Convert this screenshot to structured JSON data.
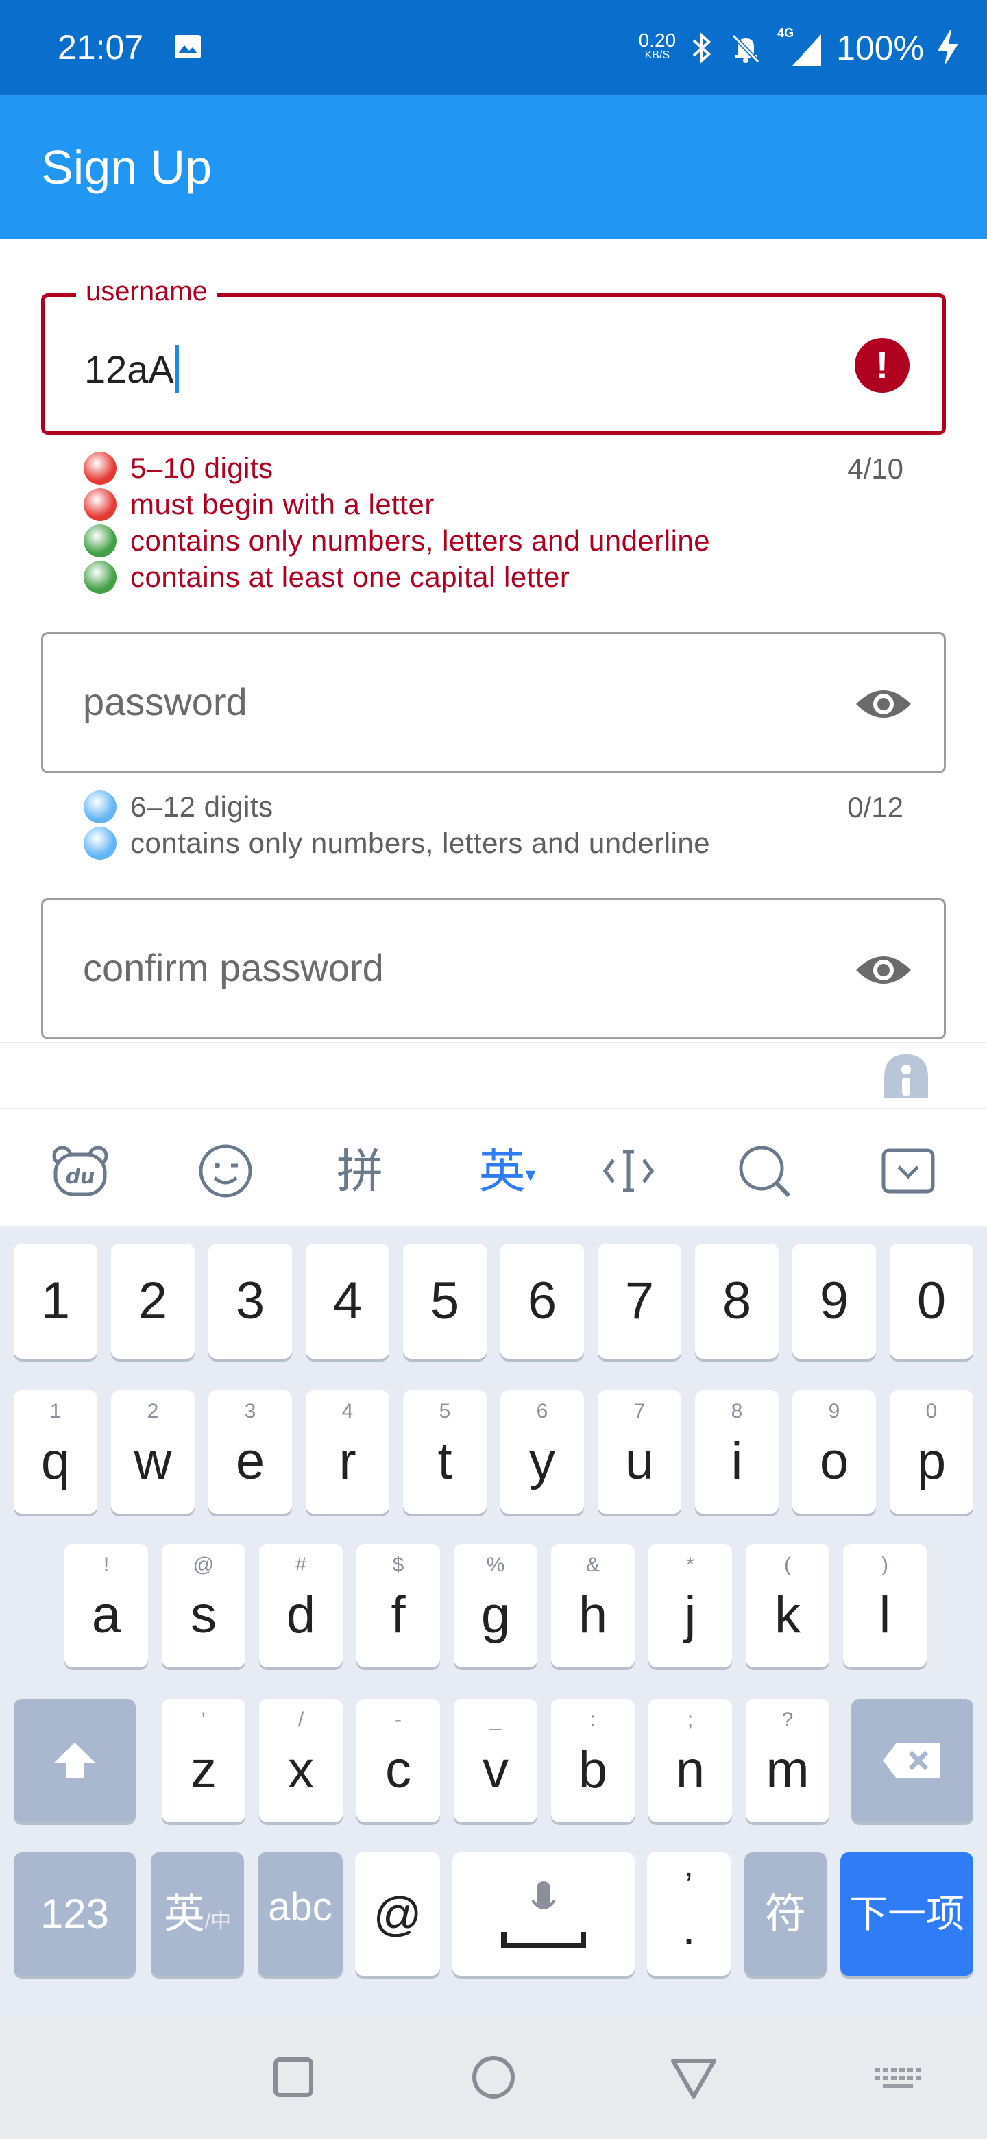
{
  "status": {
    "time": "21:07",
    "net_speed": "0.20",
    "net_unit": "KB/S",
    "signal": "4G",
    "battery": "100%"
  },
  "appbar": {
    "title": "Sign Up"
  },
  "username": {
    "label": "username",
    "value": "12aA",
    "counter": "4/10",
    "rules": [
      {
        "text": "5–10 digits",
        "status": "fail",
        "color": "#e53935"
      },
      {
        "text": "must begin with a letter",
        "status": "fail",
        "color": "#e53935"
      },
      {
        "text": "contains only numbers, letters and underline",
        "status": "pass",
        "color": "#43a047"
      },
      {
        "text": "contains at least one capital letter",
        "status": "pass",
        "color": "#43a047"
      }
    ]
  },
  "password": {
    "placeholder": "password",
    "counter": "0/12",
    "rules": [
      {
        "text": "6–12 digits",
        "status": "neutral",
        "color": "#64b5f6"
      },
      {
        "text": "contains only numbers, letters and underline",
        "status": "neutral",
        "color": "#64b5f6"
      }
    ]
  },
  "confirm": {
    "placeholder": "confirm password"
  },
  "keyboard": {
    "toolbar": {
      "pinyin": "拼",
      "english": "英"
    },
    "number_row": [
      "1",
      "2",
      "3",
      "4",
      "5",
      "6",
      "7",
      "8",
      "9",
      "0"
    ],
    "row1": [
      {
        "k": "q",
        "h": "1"
      },
      {
        "k": "w",
        "h": "2"
      },
      {
        "k": "e",
        "h": "3"
      },
      {
        "k": "r",
        "h": "4"
      },
      {
        "k": "t",
        "h": "5"
      },
      {
        "k": "y",
        "h": "6"
      },
      {
        "k": "u",
        "h": "7"
      },
      {
        "k": "i",
        "h": "8"
      },
      {
        "k": "o",
        "h": "9"
      },
      {
        "k": "p",
        "h": "0"
      }
    ],
    "row2": [
      {
        "k": "a",
        "h": "!"
      },
      {
        "k": "s",
        "h": "@"
      },
      {
        "k": "d",
        "h": "#"
      },
      {
        "k": "f",
        "h": "$"
      },
      {
        "k": "g",
        "h": "%"
      },
      {
        "k": "h",
        "h": "&"
      },
      {
        "k": "j",
        "h": "*"
      },
      {
        "k": "k",
        "h": "("
      },
      {
        "k": "l",
        "h": ")"
      }
    ],
    "row3": [
      {
        "k": "z",
        "h": "'"
      },
      {
        "k": "x",
        "h": "/"
      },
      {
        "k": "c",
        "h": "-"
      },
      {
        "k": "v",
        "h": "_"
      },
      {
        "k": "b",
        "h": ":"
      },
      {
        "k": "n",
        "h": ";"
      },
      {
        "k": "m",
        "h": "?"
      }
    ],
    "bottom": {
      "num_label": "123",
      "lang_label": "英",
      "lang_sub": "/中",
      "abc_label": "abc",
      "at_label": "@",
      "punct_top": "’",
      "punct_bottom": ".",
      "symbols_label": "符",
      "next_label": "下一项"
    }
  }
}
